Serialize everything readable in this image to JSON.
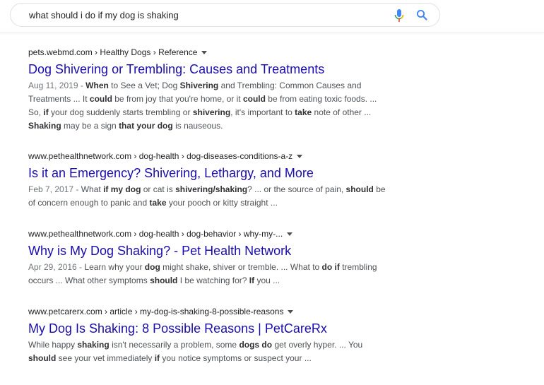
{
  "search": {
    "query": "what should i do if my dog is shaking"
  },
  "icons": {
    "mic": "microphone-icon",
    "search": "magnifier-icon",
    "menu": "caret-down-icon"
  },
  "colors": {
    "link": "#1a0dab",
    "text": "#4d5156",
    "mic_blue": "#4285f4",
    "mic_red": "#ea4335",
    "mic_yellow": "#fbbc05",
    "mic_green": "#34a853"
  },
  "results": [
    {
      "cite": "pets.webmd.com › Healthy Dogs › Reference",
      "title": "Dog Shivering or Trembling: Causes and Treatments",
      "snippet_lines": [
        [
          {
            "t": "Aug 11, 2019 - ",
            "b": false,
            "date": true
          },
          {
            "t": "When",
            "b": true
          },
          {
            "t": " to See a Vet; Dog ",
            "b": false
          },
          {
            "t": "Shivering",
            "b": true
          },
          {
            "t": " and Trembling: Common Causes and",
            "b": false
          }
        ],
        [
          {
            "t": "Treatments ... It ",
            "b": false
          },
          {
            "t": "could",
            "b": true
          },
          {
            "t": " be from joy that you're home, or it ",
            "b": false
          },
          {
            "t": "could",
            "b": true
          },
          {
            "t": " be from eating toxic foods. ...",
            "b": false
          }
        ],
        [
          {
            "t": "So, ",
            "b": false
          },
          {
            "t": "if",
            "b": true
          },
          {
            "t": " your dog suddenly starts trembling or ",
            "b": false
          },
          {
            "t": "shivering",
            "b": true
          },
          {
            "t": ", it's important to ",
            "b": false
          },
          {
            "t": "take",
            "b": true
          },
          {
            "t": " note of other ...",
            "b": false
          }
        ],
        [
          {
            "t": "Shaking",
            "b": true
          },
          {
            "t": " may be a sign ",
            "b": false
          },
          {
            "t": "that your dog",
            "b": true
          },
          {
            "t": " is nauseous.",
            "b": false
          }
        ]
      ]
    },
    {
      "cite": "www.pethealthnetwork.com › dog-health › dog-diseases-conditions-a-z",
      "title": "Is it an Emergency? Shivering, Lethargy, and More",
      "snippet_lines": [
        [
          {
            "t": "Feb 7, 2017 - ",
            "b": false,
            "date": true
          },
          {
            "t": "What ",
            "b": false
          },
          {
            "t": "if my dog",
            "b": true
          },
          {
            "t": " or cat is ",
            "b": false
          },
          {
            "t": "shivering/shaking",
            "b": true
          },
          {
            "t": "? ... or the source of pain, ",
            "b": false
          },
          {
            "t": "should",
            "b": true
          },
          {
            "t": " be",
            "b": false
          }
        ],
        [
          {
            "t": "of concern enough to panic and ",
            "b": false
          },
          {
            "t": "take",
            "b": true
          },
          {
            "t": " your pooch or kitty straight ...",
            "b": false
          }
        ]
      ]
    },
    {
      "cite": "www.pethealthnetwork.com › dog-health › dog-behavior › why-my-...",
      "title": "Why is My Dog Shaking? - Pet Health Network",
      "snippet_lines": [
        [
          {
            "t": "Apr 29, 2016 - ",
            "b": false,
            "date": true
          },
          {
            "t": "Learn why your ",
            "b": false
          },
          {
            "t": "dog",
            "b": true
          },
          {
            "t": " might shake, shiver or tremble. ... What to ",
            "b": false
          },
          {
            "t": "do if",
            "b": true
          },
          {
            "t": " trembling",
            "b": false
          }
        ],
        [
          {
            "t": "occurs ... What other symptoms ",
            "b": false
          },
          {
            "t": "should",
            "b": true
          },
          {
            "t": " I be watching for? ",
            "b": false
          },
          {
            "t": "If",
            "b": true
          },
          {
            "t": " you ...",
            "b": false
          }
        ]
      ]
    },
    {
      "cite": "www.petcarerx.com › article › my-dog-is-shaking-8-possible-reasons",
      "title": "My Dog Is Shaking: 8 Possible Reasons | PetCareRx",
      "snippet_lines": [
        [
          {
            "t": "While happy ",
            "b": false
          },
          {
            "t": "shaking",
            "b": true
          },
          {
            "t": " isn't necessarily a problem, some ",
            "b": false
          },
          {
            "t": "dogs do",
            "b": true
          },
          {
            "t": " get overly hyper. ... You",
            "b": false
          }
        ],
        [
          {
            "t": "should",
            "b": true
          },
          {
            "t": " see your vet immediately ",
            "b": false
          },
          {
            "t": "if",
            "b": true
          },
          {
            "t": " you notice symptoms or suspect your ...",
            "b": false
          }
        ]
      ]
    }
  ]
}
